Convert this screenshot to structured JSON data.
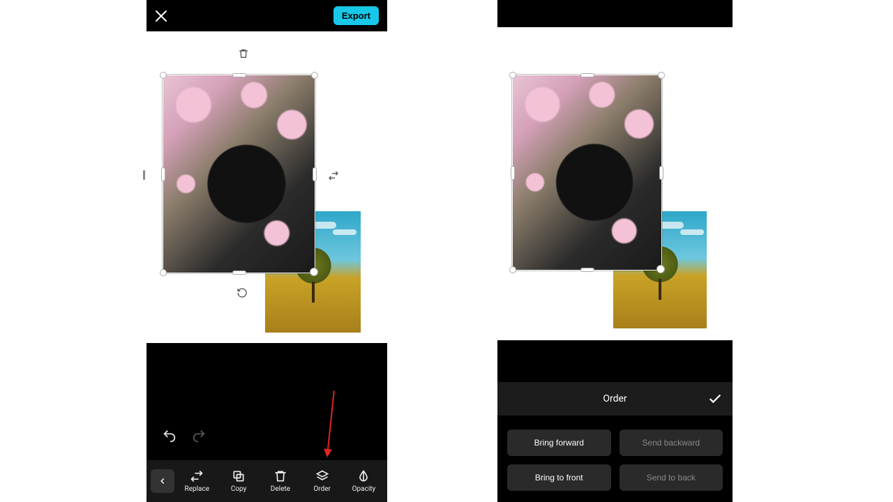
{
  "left": {
    "export_label": "Export",
    "toolbar": {
      "replace": "Replace",
      "copy": "Copy",
      "delete": "Delete",
      "order": "Order",
      "opacity": "Opacity"
    }
  },
  "right": {
    "order_title": "Order",
    "buttons": {
      "bring_forward": "Bring forward",
      "send_backward": "Send backward",
      "bring_to_front": "Bring to front",
      "send_to_back": "Send to back"
    }
  }
}
